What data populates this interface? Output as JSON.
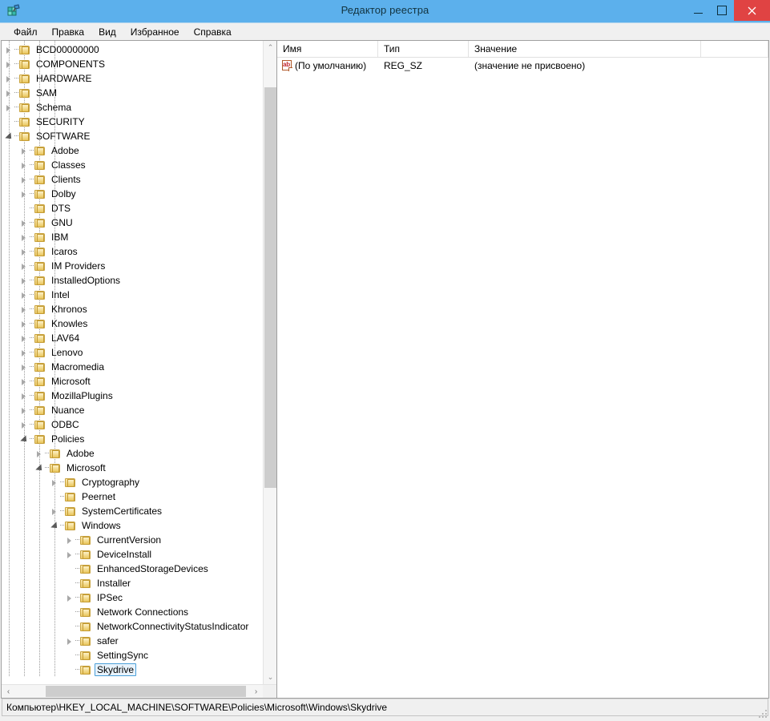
{
  "window": {
    "title": "Редактор реестра",
    "icon": "registry-editor-icon",
    "minimize_label": "—",
    "maximize_label": "□",
    "close_label": "✕"
  },
  "menubar": {
    "items": [
      {
        "label": "Файл"
      },
      {
        "label": "Правка"
      },
      {
        "label": "Вид"
      },
      {
        "label": "Избранное"
      },
      {
        "label": "Справка"
      }
    ]
  },
  "tree": {
    "nodes": [
      {
        "label": "BCD00000000",
        "depth": 1,
        "state": "collapsed",
        "selected": false
      },
      {
        "label": "COMPONENTS",
        "depth": 1,
        "state": "collapsed",
        "selected": false
      },
      {
        "label": "HARDWARE",
        "depth": 1,
        "state": "collapsed",
        "selected": false
      },
      {
        "label": "SAM",
        "depth": 1,
        "state": "collapsed",
        "selected": false
      },
      {
        "label": "Schema",
        "depth": 1,
        "state": "collapsed",
        "selected": false
      },
      {
        "label": "SECURITY",
        "depth": 1,
        "state": "leaf",
        "selected": false
      },
      {
        "label": "SOFTWARE",
        "depth": 1,
        "state": "expanded",
        "selected": false
      },
      {
        "label": "Adobe",
        "depth": 2,
        "state": "collapsed",
        "selected": false
      },
      {
        "label": "Classes",
        "depth": 2,
        "state": "collapsed",
        "selected": false
      },
      {
        "label": "Clients",
        "depth": 2,
        "state": "collapsed",
        "selected": false
      },
      {
        "label": "Dolby",
        "depth": 2,
        "state": "collapsed",
        "selected": false
      },
      {
        "label": "DTS",
        "depth": 2,
        "state": "leaf",
        "selected": false
      },
      {
        "label": "GNU",
        "depth": 2,
        "state": "collapsed",
        "selected": false
      },
      {
        "label": "IBM",
        "depth": 2,
        "state": "collapsed",
        "selected": false
      },
      {
        "label": "Icaros",
        "depth": 2,
        "state": "collapsed",
        "selected": false
      },
      {
        "label": "IM Providers",
        "depth": 2,
        "state": "collapsed",
        "selected": false
      },
      {
        "label": "InstalledOptions",
        "depth": 2,
        "state": "collapsed",
        "selected": false
      },
      {
        "label": "Intel",
        "depth": 2,
        "state": "collapsed",
        "selected": false
      },
      {
        "label": "Khronos",
        "depth": 2,
        "state": "collapsed",
        "selected": false
      },
      {
        "label": "Knowles",
        "depth": 2,
        "state": "collapsed",
        "selected": false
      },
      {
        "label": "LAV64",
        "depth": 2,
        "state": "collapsed",
        "selected": false
      },
      {
        "label": "Lenovo",
        "depth": 2,
        "state": "collapsed",
        "selected": false
      },
      {
        "label": "Macromedia",
        "depth": 2,
        "state": "collapsed",
        "selected": false
      },
      {
        "label": "Microsoft",
        "depth": 2,
        "state": "collapsed",
        "selected": false
      },
      {
        "label": "MozillaPlugins",
        "depth": 2,
        "state": "collapsed",
        "selected": false
      },
      {
        "label": "Nuance",
        "depth": 2,
        "state": "collapsed",
        "selected": false
      },
      {
        "label": "ODBC",
        "depth": 2,
        "state": "collapsed",
        "selected": false
      },
      {
        "label": "Policies",
        "depth": 2,
        "state": "expanded",
        "selected": false
      },
      {
        "label": "Adobe",
        "depth": 3,
        "state": "collapsed",
        "selected": false
      },
      {
        "label": "Microsoft",
        "depth": 3,
        "state": "expanded",
        "selected": false
      },
      {
        "label": "Cryptography",
        "depth": 4,
        "state": "collapsed",
        "selected": false
      },
      {
        "label": "Peernet",
        "depth": 4,
        "state": "leaf",
        "selected": false
      },
      {
        "label": "SystemCertificates",
        "depth": 4,
        "state": "collapsed",
        "selected": false
      },
      {
        "label": "Windows",
        "depth": 4,
        "state": "expanded",
        "selected": false
      },
      {
        "label": "CurrentVersion",
        "depth": 5,
        "state": "collapsed",
        "selected": false
      },
      {
        "label": "DeviceInstall",
        "depth": 5,
        "state": "collapsed",
        "selected": false
      },
      {
        "label": "EnhancedStorageDevices",
        "depth": 5,
        "state": "leaf",
        "selected": false
      },
      {
        "label": "Installer",
        "depth": 5,
        "state": "leaf",
        "selected": false
      },
      {
        "label": "IPSec",
        "depth": 5,
        "state": "collapsed",
        "selected": false
      },
      {
        "label": "Network Connections",
        "depth": 5,
        "state": "leaf",
        "selected": false
      },
      {
        "label": "NetworkConnectivityStatusIndicator",
        "depth": 5,
        "state": "leaf",
        "selected": false
      },
      {
        "label": "safer",
        "depth": 5,
        "state": "collapsed",
        "selected": false
      },
      {
        "label": "SettingSync",
        "depth": 5,
        "state": "leaf",
        "selected": false
      },
      {
        "label": "Skydrive",
        "depth": 5,
        "state": "leaf",
        "selected": true
      }
    ]
  },
  "listview": {
    "columns": [
      {
        "label": "Имя"
      },
      {
        "label": "Тип"
      },
      {
        "label": "Значение"
      },
      {
        "label": ""
      }
    ],
    "rows": [
      {
        "icon": "string-value-icon",
        "name": "(По умолчанию)",
        "type": "REG_SZ",
        "value": "(значение не присвоено)"
      }
    ]
  },
  "statusbar": {
    "path": "Компьютер\\HKEY_LOCAL_MACHINE\\SOFTWARE\\Policies\\Microsoft\\Windows\\Skydrive"
  },
  "scrollbars": {
    "vertical_up": "⌃",
    "vertical_down": "⌄",
    "horizontal_left": "‹",
    "horizontal_right": "›"
  },
  "colors": {
    "titlebar": "#5cb0ec",
    "close_button": "#e04343",
    "selection_fill": "#e8f3fc",
    "selection_border": "#4a9fd8",
    "folder": "#eac96a"
  }
}
